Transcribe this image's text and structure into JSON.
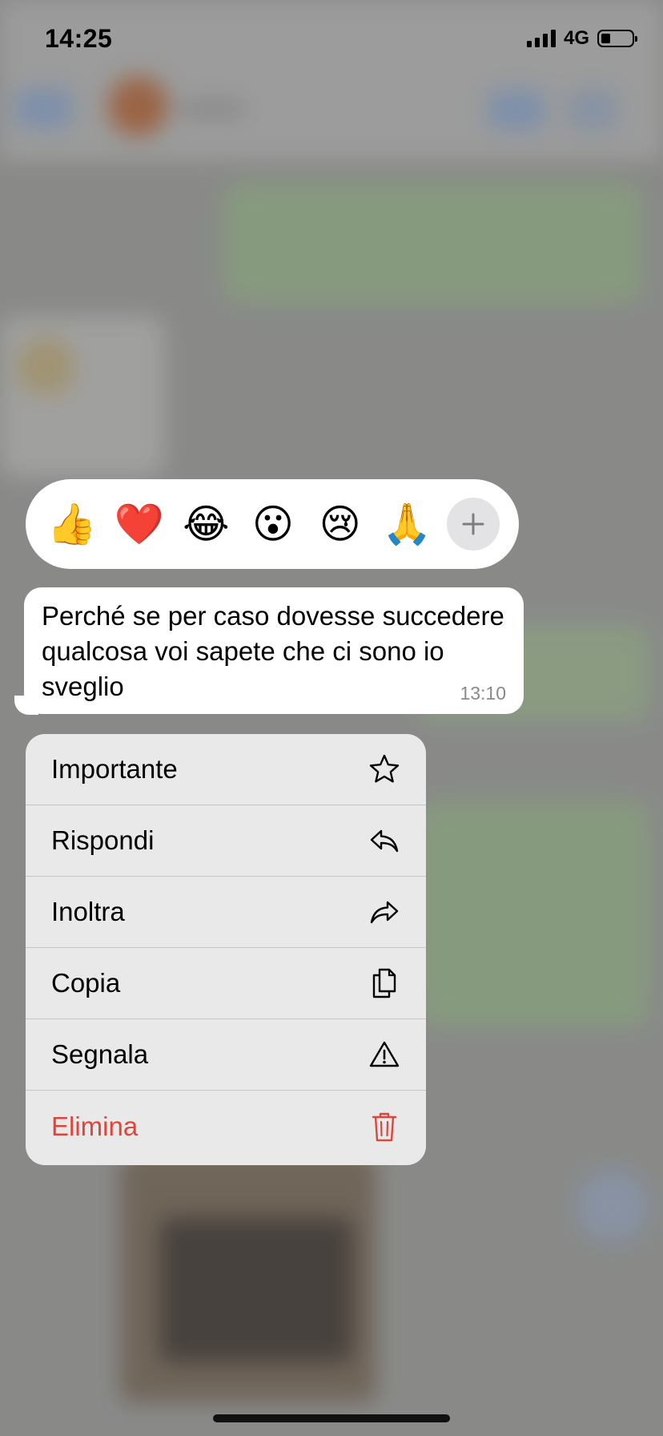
{
  "status_bar": {
    "time": "14:25",
    "network": "4G",
    "battery_level": 0.3
  },
  "reactions": {
    "emojis": [
      "👍",
      "❤️",
      "😂",
      "😮",
      "😢",
      "🙏"
    ],
    "more_label": "+"
  },
  "message": {
    "text": "Perché se per caso dovesse succedere qualcosa voi sapete che ci sono io sveglio",
    "time": "13:10"
  },
  "menu": {
    "items": [
      {
        "label": "Importante",
        "icon": "star-icon"
      },
      {
        "label": "Rispondi",
        "icon": "reply-icon"
      },
      {
        "label": "Inoltra",
        "icon": "forward-icon"
      },
      {
        "label": "Copia",
        "icon": "copy-icon"
      },
      {
        "label": "Segnala",
        "icon": "warning-icon"
      },
      {
        "label": "Elimina",
        "icon": "trash-icon",
        "destructive": true
      }
    ]
  },
  "colors": {
    "destructive": "#e0443a",
    "bubble": "#ffffff",
    "menu_bg": "#e9e9e9"
  }
}
